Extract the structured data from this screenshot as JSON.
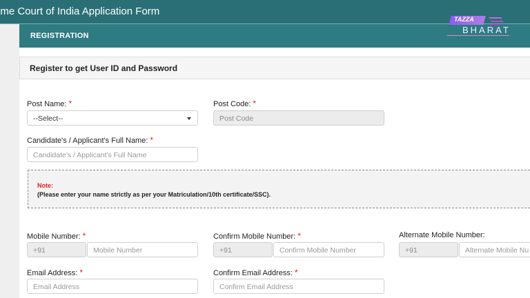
{
  "window": {
    "title": "eme Court of India Application Form"
  },
  "section": {
    "title": "REGISTRATION"
  },
  "logo": {
    "top": "TAZZA",
    "bottom": "BHARAT"
  },
  "panel": {
    "heading": "Register to get User ID and Password"
  },
  "form": {
    "post_name": {
      "label": "Post Name:",
      "required": "*",
      "value": "--Select--"
    },
    "post_code": {
      "label": "Post Code:",
      "required": "*",
      "placeholder": "Post Code"
    },
    "full_name": {
      "label": "Candidate's / Applicant's Full Name:",
      "required": "*",
      "placeholder": "Candidate's / Applicant's Full Name"
    },
    "note": {
      "title": "Note:",
      "text": "(Please enter your name strictly as per your Matriculation/10th certificate/SSC)."
    },
    "mobile": {
      "label": "Mobile Number:",
      "required": "*",
      "code": "+91",
      "placeholder": "Mobile Number"
    },
    "confirm_mobile": {
      "label": "Confirm Mobile Number:",
      "required": "*",
      "code": "+91",
      "placeholder": "Confirm Mobile Number"
    },
    "alt_mobile": {
      "label": "Alternate Mobile Number:",
      "code": "+91",
      "placeholder": "Alternate Mobile Nu"
    },
    "email": {
      "label": "Email Address:",
      "required": "*",
      "placeholder": "Email Address"
    },
    "confirm_email": {
      "label": "Confirm Email Address:",
      "required": "*",
      "placeholder": "Confirm Email Address"
    }
  },
  "colors": {
    "header": "#2a6f76",
    "section": "#2e7b82",
    "required": "#e02020"
  }
}
